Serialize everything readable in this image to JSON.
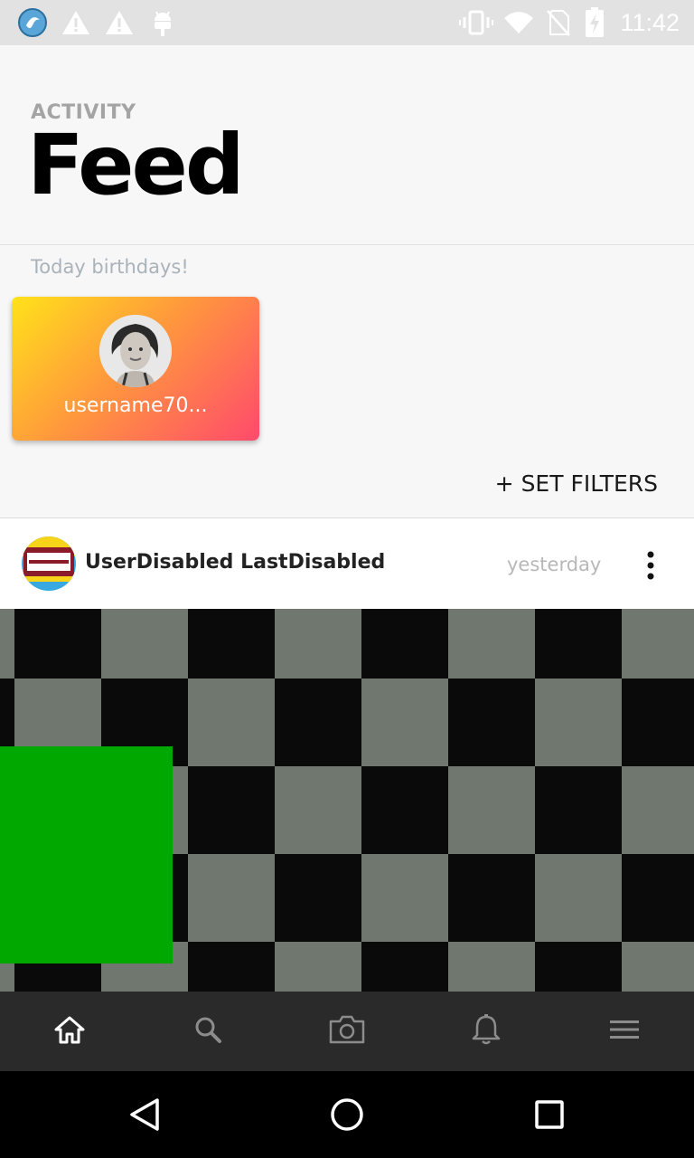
{
  "status_bar": {
    "time": "11:42",
    "left_icons": [
      "app-logo-icon",
      "warning-icon",
      "warning-icon",
      "android-icon"
    ],
    "right_icons": [
      "vibrate-icon",
      "wifi-icon",
      "no-sim-icon",
      "battery-charging-icon"
    ]
  },
  "header": {
    "eyebrow": "ACTIVITY",
    "title": "Feed"
  },
  "birthdays": {
    "label": "Today birthdays!",
    "cards": [
      {
        "username": "username70..."
      }
    ]
  },
  "filters": {
    "label": "+ SET FILTERS"
  },
  "post": {
    "author": "UserDisabled LastDisabled",
    "time": "yesterday",
    "menu_icon": "more-vertical-icon"
  },
  "bottom_nav": {
    "items": [
      {
        "icon": "home-icon",
        "active": true
      },
      {
        "icon": "search-icon",
        "active": false
      },
      {
        "icon": "camera-icon",
        "active": false
      },
      {
        "icon": "bell-icon",
        "active": false
      },
      {
        "icon": "menu-icon",
        "active": false
      }
    ]
  },
  "system_nav": {
    "buttons": [
      "back-icon",
      "home-circle-icon",
      "recents-icon"
    ]
  },
  "colors": {
    "card_gradient_start": "#ffe21a",
    "card_gradient_end": "#ff4a6c",
    "nav_background": "#2a2a2a",
    "accent_green": "#00a800"
  }
}
